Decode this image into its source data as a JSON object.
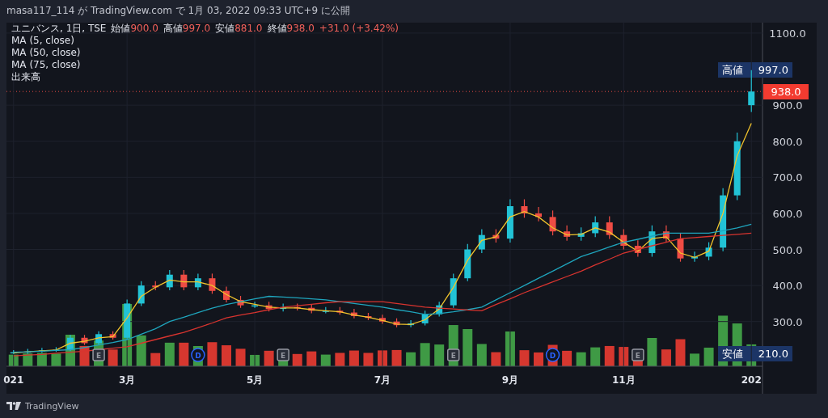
{
  "header": {
    "text": "masa117_114 が TradingView.com で 1月 03, 2022 09:33 UTC+9 に公開"
  },
  "legend": {
    "symbol": "ユニバンス, 1日, TSE",
    "ohlc": [
      {
        "label": "始値",
        "value": "900.0"
      },
      {
        "label": "高値",
        "value": "997.0"
      },
      {
        "label": "安値",
        "value": "881.0"
      },
      {
        "label": "終値",
        "value": "938.0"
      }
    ],
    "change": "+31.0 (+3.42%)",
    "volume_label": "出来高"
  },
  "price_tags": [
    {
      "kind": "high",
      "label": "高値",
      "value": "997.0"
    },
    {
      "kind": "last",
      "value": "938.0"
    },
    {
      "kind": "low",
      "label": "安値",
      "value": "210.0"
    }
  ],
  "event_markers": [
    {
      "kind": "none"
    },
    {
      "kind": "none"
    },
    {
      "kind": "none"
    },
    {
      "kind": "none"
    },
    {
      "kind": "none"
    },
    {
      "kind": "none"
    },
    {
      "kind": "earnings",
      "label": "E"
    },
    {
      "kind": "none"
    },
    {
      "kind": "none"
    },
    {
      "kind": "none"
    },
    {
      "kind": "none"
    },
    {
      "kind": "none"
    },
    {
      "kind": "none"
    },
    {
      "kind": "dividend",
      "label": "D"
    },
    {
      "kind": "none"
    },
    {
      "kind": "none"
    },
    {
      "kind": "none"
    },
    {
      "kind": "none"
    },
    {
      "kind": "none"
    },
    {
      "kind": "earnings",
      "label": "E"
    },
    {
      "kind": "none"
    },
    {
      "kind": "none"
    },
    {
      "kind": "none"
    },
    {
      "kind": "none"
    },
    {
      "kind": "none"
    },
    {
      "kind": "none"
    },
    {
      "kind": "none"
    },
    {
      "kind": "none"
    },
    {
      "kind": "none"
    },
    {
      "kind": "none"
    },
    {
      "kind": "none"
    },
    {
      "kind": "earnings",
      "label": "E"
    },
    {
      "kind": "none"
    },
    {
      "kind": "none"
    },
    {
      "kind": "none"
    },
    {
      "kind": "none"
    },
    {
      "kind": "none"
    },
    {
      "kind": "none"
    },
    {
      "kind": "dividend",
      "label": "D"
    },
    {
      "kind": "none"
    },
    {
      "kind": "none"
    },
    {
      "kind": "none"
    },
    {
      "kind": "none"
    },
    {
      "kind": "none"
    },
    {
      "kind": "earnings",
      "label": "E"
    },
    {
      "kind": "none"
    },
    {
      "kind": "none"
    },
    {
      "kind": "none"
    },
    {
      "kind": "none"
    },
    {
      "kind": "none"
    },
    {
      "kind": "none"
    },
    {
      "kind": "none"
    },
    {
      "kind": "none"
    }
  ],
  "chart_data": {
    "type": "candlestick",
    "grid": true,
    "ylim": [
      176,
      1129
    ],
    "categories": [
      "021",
      null,
      null,
      null,
      null,
      null,
      null,
      null,
      "3月",
      null,
      null,
      null,
      null,
      null,
      null,
      null,
      null,
      "5月",
      null,
      null,
      null,
      null,
      null,
      null,
      null,
      null,
      "7月",
      null,
      null,
      null,
      null,
      null,
      null,
      null,
      null,
      "9月",
      null,
      null,
      null,
      null,
      null,
      null,
      null,
      "11月",
      null,
      null,
      null,
      null,
      null,
      null,
      null,
      null,
      "202"
    ],
    "yticks": [
      {
        "value": 1100,
        "label": "1100.0"
      },
      {
        "value": 900,
        "label": "900.0"
      },
      {
        "value": 800,
        "label": "800.0"
      },
      {
        "value": 700,
        "label": "700.0"
      },
      {
        "value": 600,
        "label": "600.0"
      },
      {
        "value": 500,
        "label": "500.0"
      },
      {
        "value": 400,
        "label": "400.0"
      },
      {
        "value": 300,
        "label": "300.0"
      }
    ],
    "ohlc": [
      [
        213,
        221,
        210,
        215
      ],
      [
        215,
        224,
        211,
        217
      ],
      [
        217,
        227,
        213,
        220
      ],
      [
        220,
        229,
        216,
        222
      ],
      [
        222,
        263,
        218,
        255
      ],
      [
        255,
        263,
        235,
        240
      ],
      [
        240,
        273,
        235,
        265
      ],
      [
        265,
        273,
        250,
        255
      ],
      [
        255,
        361,
        250,
        350
      ],
      [
        350,
        412,
        343,
        400
      ],
      [
        400,
        412,
        387,
        395
      ],
      [
        395,
        443,
        387,
        430
      ],
      [
        430,
        443,
        387,
        395
      ],
      [
        395,
        433,
        387,
        420
      ],
      [
        420,
        433,
        377,
        385
      ],
      [
        385,
        397,
        353,
        360
      ],
      [
        360,
        371,
        338,
        345
      ],
      [
        345,
        355,
        338,
        345
      ],
      [
        345,
        355,
        328,
        335
      ],
      [
        335,
        350,
        328,
        340
      ],
      [
        340,
        350,
        331,
        338
      ],
      [
        338,
        348,
        323,
        330
      ],
      [
        330,
        340,
        323,
        330
      ],
      [
        330,
        340,
        319,
        325
      ],
      [
        325,
        335,
        309,
        315
      ],
      [
        315,
        324,
        304,
        310
      ],
      [
        310,
        319,
        294,
        300
      ],
      [
        300,
        309,
        284,
        290
      ],
      [
        290,
        304,
        284,
        295
      ],
      [
        295,
        330,
        289,
        320
      ],
      [
        320,
        355,
        314,
        345
      ],
      [
        345,
        433,
        338,
        420
      ],
      [
        420,
        515,
        412,
        500
      ],
      [
        500,
        556,
        490,
        540
      ],
      [
        540,
        556,
        519,
        530
      ],
      [
        530,
        639,
        519,
        620
      ],
      [
        620,
        639,
        588,
        600
      ],
      [
        600,
        618,
        578,
        590
      ],
      [
        590,
        608,
        539,
        550
      ],
      [
        550,
        567,
        524,
        535
      ],
      [
        535,
        561,
        524,
        545
      ],
      [
        545,
        592,
        534,
        575
      ],
      [
        575,
        592,
        529,
        540
      ],
      [
        540,
        556,
        500,
        510
      ],
      [
        510,
        525,
        480,
        490
      ],
      [
        490,
        567,
        480,
        550
      ],
      [
        550,
        567,
        519,
        530
      ],
      [
        530,
        546,
        466,
        475
      ],
      [
        475,
        494,
        466,
        480
      ],
      [
        480,
        520,
        470,
        505
      ],
      [
        505,
        670,
        495,
        650
      ],
      [
        650,
        824,
        637,
        800
      ],
      [
        900,
        997,
        881,
        938
      ]
    ],
    "series": [
      {
        "type": "line",
        "name": "MA (5, close)",
        "color": "#f2c42c",
        "values": [
          213,
          216,
          219,
          221,
          240,
          245,
          255,
          258,
          310,
          370,
          395,
          415,
          410,
          410,
          400,
          375,
          355,
          348,
          340,
          338,
          338,
          333,
          330,
          327,
          318,
          312,
          303,
          293,
          292,
          305,
          335,
          395,
          470,
          525,
          535,
          590,
          605,
          590,
          560,
          540,
          542,
          560,
          548,
          520,
          495,
          530,
          535,
          490,
          478,
          495,
          600,
          760,
          850
        ]
      },
      {
        "type": "line",
        "name": "MA (50, close)",
        "color": "#1fa5bd",
        "values": [
          215,
          216,
          218,
          220,
          222,
          228,
          235,
          242,
          250,
          265,
          280,
          300,
          312,
          325,
          337,
          347,
          355,
          363,
          370,
          368,
          366,
          363,
          360,
          355,
          350,
          345,
          340,
          333,
          327,
          320,
          322,
          327,
          333,
          340,
          360,
          380,
          400,
          420,
          440,
          460,
          480,
          493,
          507,
          520,
          528,
          537,
          545,
          545,
          545,
          545,
          552,
          560,
          570
        ]
      },
      {
        "type": "line",
        "name": "MA (75, close)",
        "color": "#d8342f",
        "values": [
          205,
          207,
          209,
          212,
          215,
          218,
          222,
          226,
          230,
          240,
          250,
          260,
          270,
          283,
          296,
          310,
          318,
          325,
          333,
          340,
          344,
          348,
          352,
          355,
          355,
          355,
          355,
          350,
          345,
          340,
          337,
          335,
          332,
          330,
          347,
          363,
          380,
          395,
          410,
          425,
          440,
          457,
          473,
          490,
          500,
          510,
          520,
          530,
          533,
          536,
          539,
          542,
          545
        ]
      }
    ]
  },
  "footer": {
    "brand": "TradingView"
  }
}
